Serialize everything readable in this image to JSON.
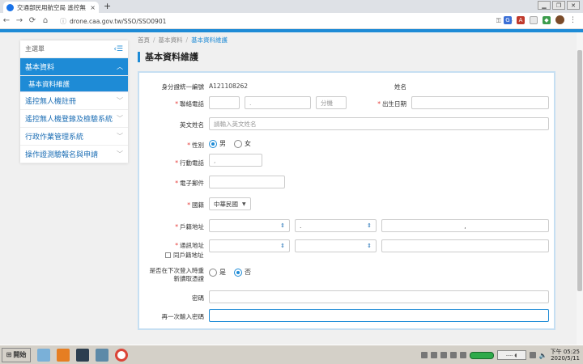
{
  "browser": {
    "tab_title": "交通部民用航空局 遙控無",
    "tab_close": "×",
    "new_tab": "+",
    "url": "drone.caa.gov.tw/SSO/SSO0901",
    "back": "←",
    "forward": "→",
    "reload": "⟳",
    "home": "⌂"
  },
  "sidebar": {
    "header": "主選單",
    "items": [
      {
        "label": "基本資料",
        "active": true
      },
      {
        "label": "遙控無人機註冊",
        "active": false
      },
      {
        "label": "遙控無人機登錄及檢驗系統",
        "active": false
      },
      {
        "label": "行政作業管理系統",
        "active": false
      },
      {
        "label": "操作證測驗報名與申請",
        "active": false
      }
    ],
    "sub_item": "基本資料維護"
  },
  "breadcrumb": {
    "home": "首頁",
    "level1": "基本資料",
    "current": "基本資料維護",
    "separator": "/"
  },
  "page_title": "基本資料維護",
  "form": {
    "id_label": "身分證統一編號",
    "id_value": "A121108262",
    "name_label": "姓名",
    "phone_label": "聯絡電話",
    "phone_dot": ".",
    "ext_placeholder": "分機",
    "birth_label": "出生日期",
    "english_name_label": "英文姓名",
    "english_name_placeholder": "請輸入英文姓名",
    "gender_label": "性別",
    "gender_male": "男",
    "gender_female": "女",
    "mobile_label": "行動電話",
    "mobile_dot": ",",
    "email_label": "電子郵件",
    "nationality_label": "國籍",
    "nationality_value": "中華民國",
    "household_addr_label": "戶籍地址",
    "household_dot1": ".",
    "household_dot2": ",",
    "mailing_addr_label": "通訊地址",
    "same_as_household": "同戶籍地址",
    "reread_label_line1": "是否在下次登入時重",
    "reread_label_line2": "新讀取憑證",
    "reread_yes": "是",
    "reread_no": "否",
    "password_label": "密碼",
    "password_again_label": "再一次輸入密碼"
  },
  "taskbar": {
    "start": "開始",
    "clock_line1": "下午 05:25",
    "clock_line2": "2020/5/11"
  },
  "colors": {
    "accent": "#1e8bd6",
    "required": "#e53935"
  }
}
